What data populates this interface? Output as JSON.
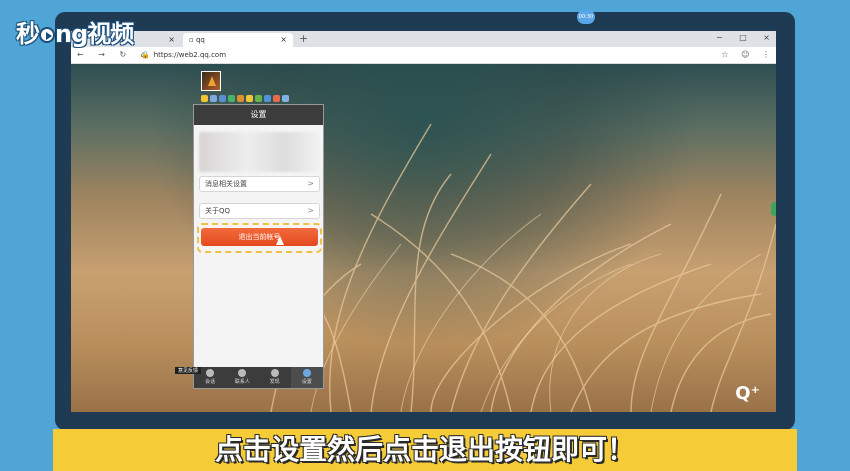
{
  "brand": {
    "logo_text_a": "秒",
    "logo_text_b": "ng视频",
    "logo_letter": "d"
  },
  "browser": {
    "tabs": [
      {
        "label": "",
        "close": "×"
      },
      {
        "label": "qq",
        "close": "×"
      }
    ],
    "new_tab": "+",
    "window_controls": [
      "−",
      "□",
      "×"
    ],
    "timer_badge": "00:30",
    "nav": "← → ↻ ⌂",
    "url": "https://web2.qq.com",
    "addr_icons": [
      "☆",
      "☺",
      "⋮"
    ]
  },
  "qq_panel": {
    "header": "设置",
    "menu_items": [
      {
        "label": "消息相关设置",
        "chevron": ">"
      },
      {
        "label": "关于QQ",
        "chevron": ">"
      }
    ],
    "logout_button": "退出当前帐号",
    "bottom_nav": [
      {
        "label": "会话",
        "icon": "chat-icon"
      },
      {
        "label": "联系人",
        "icon": "contacts-icon"
      },
      {
        "label": "发现",
        "icon": "star-icon"
      },
      {
        "label": "设置",
        "icon": "gear-icon",
        "active": true
      }
    ],
    "feedback": "意见反馈"
  },
  "corner_logo": "Q⁺",
  "caption": "点击设置然后点击退出按钮即可！",
  "colors": {
    "page_bg": "#4fa6d6",
    "monitor": "#1f3a53",
    "caption_bar": "#f5cc37",
    "logout": "#e34a1e",
    "highlight": "#f0c040"
  }
}
